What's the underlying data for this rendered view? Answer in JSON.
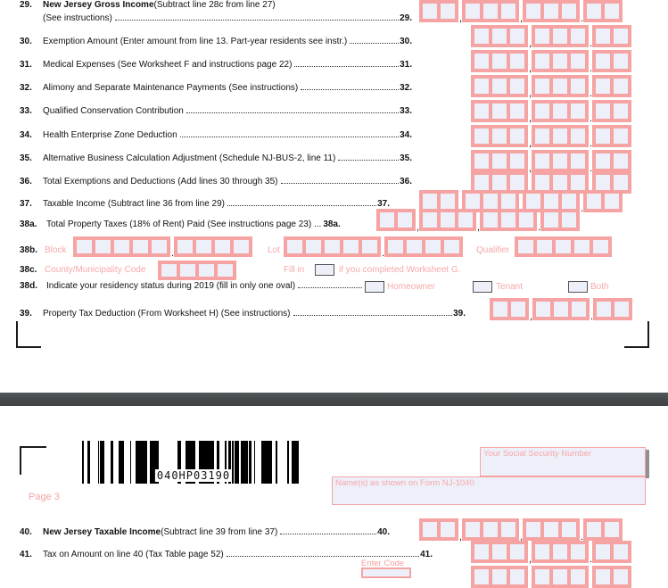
{
  "document": {
    "form_name": "NJ-1040",
    "tax_year": "2019",
    "page_label": "Page 3",
    "barcode_value": "040HP03190"
  },
  "colors": {
    "box_border": "#f6a3a3",
    "box_fill": "#edeff9",
    "pink_label": "#f7a8a8",
    "separator_band": "#464a4d",
    "text": "#111111"
  },
  "page1": {
    "lines": [
      {
        "number": "29.",
        "bold_text": "New Jersey Gross Income",
        "text": " (Subtract line 28c from line 27)",
        "text2": "(See instructions)",
        "tail": "29."
      },
      {
        "number": "30.",
        "bold_text": "",
        "text": "Exemption Amount (Enter amount from line 13. Part-year residents see instr.)",
        "tail": "30."
      },
      {
        "number": "31.",
        "bold_text": "",
        "text": "Medical Expenses (See Worksheet F and instructions page 22)",
        "tail": "31."
      },
      {
        "number": "32.",
        "bold_text": "",
        "text": "Alimony and Separate Maintenance Payments (See instructions)",
        "tail": "32."
      },
      {
        "number": "33.",
        "bold_text": "",
        "text": "Qualified Conservation Contribution",
        "tail": "33."
      },
      {
        "number": "34.",
        "bold_text": "",
        "text": "Health Enterprise Zone Deduction",
        "tail": "34."
      },
      {
        "number": "35.",
        "bold_text": "",
        "text": "Alternative Business Calculation Adjustment (Schedule NJ-BUS-2, line 11)",
        "tail": "35."
      },
      {
        "number": "36.",
        "bold_text": "",
        "text": "Total Exemptions and Deductions (Add lines 30 through 35)",
        "tail": "36."
      },
      {
        "number": "37.",
        "bold_text": "",
        "text": "Taxable Income (Subtract line 36 from line 29)",
        "tail": "37."
      },
      {
        "number": "38a.",
        "bold_text": "",
        "text": "Total Property Taxes (18% of Rent) Paid (See instructions page 23) ...",
        "tail": "38a."
      },
      {
        "number": "39.",
        "bold_text": "",
        "text": "Property Tax Deduction (From Worksheet H) (See instructions)",
        "tail": "39."
      }
    ],
    "line38b": {
      "number": "38b.",
      "label_block": "Block",
      "label_lot": "Lot",
      "label_qualifier": "Qualifier"
    },
    "line38c": {
      "number": "38c.",
      "label": "County/Municipality Code",
      "fill_in_prefix": "Fill in",
      "fill_in_suffix": "if you completed Worksheet G."
    },
    "line38d": {
      "number": "38d.",
      "text": "Indicate your residency status during 2019 (fill in only one oval)",
      "options": [
        "Homeowner",
        "Tenant",
        "Both"
      ]
    }
  },
  "page3": {
    "ssn_field_label": "Your Social Security Number",
    "name_field_label": "Name(s) as shown on Form NJ-1040",
    "page_label": "Page 3",
    "barcode_value": "040HP03190",
    "lines": [
      {
        "number": "40.",
        "bold_text": "New Jersey Taxable Income",
        "text": " (Subtract line 39 from line 37)",
        "tail": "40."
      },
      {
        "number": "41.",
        "bold_text": "",
        "text": "Tax on Amount on line 40 (Tax Table page 52)",
        "tail": "41."
      }
    ],
    "enter_code_label": "Enter Code"
  }
}
